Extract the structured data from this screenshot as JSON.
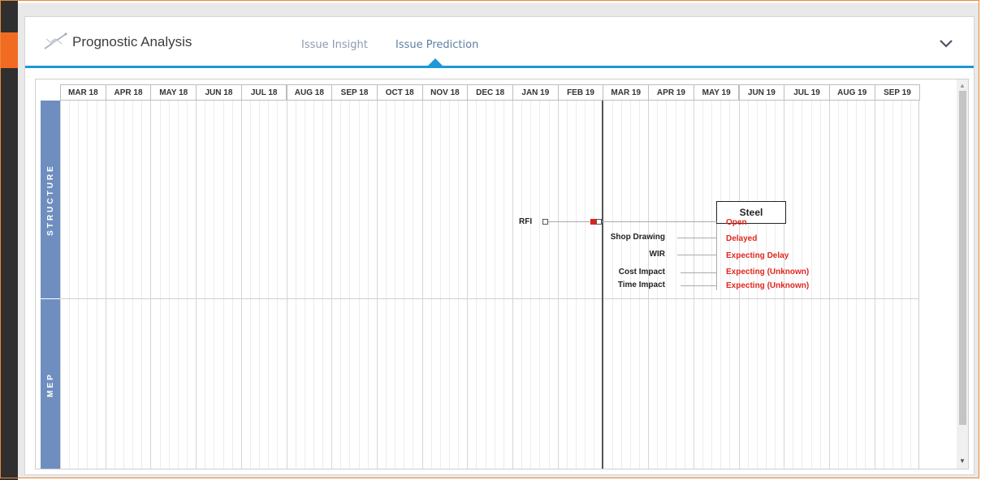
{
  "app": {
    "title": "Prognostic Analysis",
    "logo_icon": "satellite-icon",
    "accent_color": "#1e98d7",
    "sidebar_accent_color": "#f26b22"
  },
  "tabs": [
    {
      "label": "Issue Insight",
      "active": false
    },
    {
      "label": "Issue Prediction",
      "active": true
    }
  ],
  "header": {
    "collapse_icon": "chevron-down-icon"
  },
  "timeline": {
    "months": [
      "MAR 18",
      "APR 18",
      "MAY 18",
      "JUN 18",
      "JUL 18",
      "AUG 18",
      "SEP 18",
      "OCT 18",
      "NOV 18",
      "DEC 18",
      "JAN 19",
      "FEB 19",
      "MAR 19",
      "APR 19",
      "MAY 19",
      "JUN 19",
      "JUL 19",
      "AUG 19",
      "SEP 19"
    ],
    "today_marker_month": "FEB 19",
    "rows": [
      {
        "label": "STRUCTURE",
        "color": "#6f8ec0"
      },
      {
        "label": "MEP",
        "color": "#6f8ec0"
      }
    ]
  },
  "prediction": {
    "package": "Steel",
    "rfi_label": "RFI",
    "items": [
      {
        "label": "",
        "status": "Open"
      },
      {
        "label": "Shop Drawing",
        "status": "Delayed"
      },
      {
        "label": "WIR",
        "status": "Expecting Delay"
      },
      {
        "label": "Cost Impact",
        "status": "Expecting (Unknown)"
      },
      {
        "label": "Time Impact",
        "status": "Expecting (Unknown)"
      }
    ],
    "status_color": "#e0261f"
  }
}
